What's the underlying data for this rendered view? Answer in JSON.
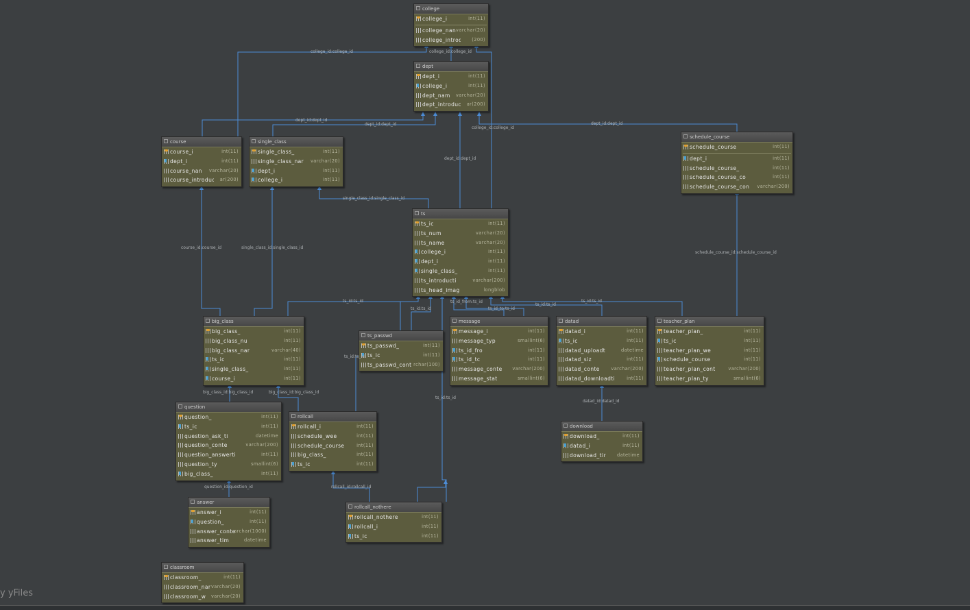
{
  "watermark": "y yFiles",
  "colors": {
    "background": "#3c3f41",
    "table_body": "#5c5c3e",
    "edge": "#4d8dd6",
    "pk": "#e0a030",
    "fk": "#4aa0d0"
  },
  "tables": [
    {
      "id": "college",
      "title": "college",
      "rows": [
        {
          "name": "college_i",
          "type": "int(11)",
          "icon": "pk"
        },
        {
          "sep": true
        },
        {
          "name": "college_nan",
          "type": "varchar(20)",
          "icon": "col"
        },
        {
          "name": "college_introduc",
          "type": "(200)",
          "icon": "col"
        }
      ]
    },
    {
      "id": "dept",
      "title": "dept",
      "rows": [
        {
          "name": "dept_i",
          "type": "int(11)",
          "icon": "pk"
        },
        {
          "name": "college_i",
          "type": "int(11)",
          "icon": "fk"
        },
        {
          "name": "dept_nam",
          "type": "varchar(20)",
          "icon": "col"
        },
        {
          "name": "dept_introduct",
          "type": "ar(200)",
          "icon": "col"
        }
      ]
    },
    {
      "id": "course",
      "title": "course",
      "rows": [
        {
          "name": "course_i",
          "type": "int(11)",
          "icon": "pk"
        },
        {
          "name": "dept_i",
          "type": "int(11)",
          "icon": "fk"
        },
        {
          "name": "course_nan",
          "type": "varchar(20)",
          "icon": "col"
        },
        {
          "name": "course_introduc",
          "type": "ar(200)",
          "icon": "col"
        }
      ]
    },
    {
      "id": "single_class",
      "title": "single_class",
      "rows": [
        {
          "name": "single_class_",
          "type": "int(11)",
          "icon": "pk"
        },
        {
          "name": "single_class_nar",
          "type": "varchar(20)",
          "icon": "col"
        },
        {
          "name": "dept_i",
          "type": "int(11)",
          "icon": "fk"
        },
        {
          "name": "college_i",
          "type": "int(11)",
          "icon": "fk"
        }
      ]
    },
    {
      "id": "schedule_course",
      "title": "schedule_course",
      "rows": [
        {
          "name": "schedule_course",
          "type": "int(11)",
          "icon": "pk"
        },
        {
          "sep": true
        },
        {
          "name": "dept_i",
          "type": "int(11)",
          "icon": "fk"
        },
        {
          "name": "schedule_course_",
          "type": "int(11)",
          "icon": "col"
        },
        {
          "name": "schedule_course_co",
          "type": "int(11)",
          "icon": "col"
        },
        {
          "name": "schedule_course_con",
          "type": "varchar(200)",
          "icon": "col"
        }
      ]
    },
    {
      "id": "ts",
      "title": "ts",
      "rows": [
        {
          "name": "ts_ic",
          "type": "int(11)",
          "icon": "pk"
        },
        {
          "name": "ts_num",
          "type": "varchar(20)",
          "icon": "col"
        },
        {
          "name": "ts_name",
          "type": "varchar(20)",
          "icon": "col"
        },
        {
          "name": "college_i",
          "type": "int(11)",
          "icon": "fk"
        },
        {
          "name": "dept_i",
          "type": "int(11)",
          "icon": "fk"
        },
        {
          "name": "single_class_",
          "type": "int(11)",
          "icon": "fk"
        },
        {
          "name": "ts_introducti",
          "type": "varchar(200)",
          "icon": "col"
        },
        {
          "name": "ts_head_imag",
          "type": "longblob",
          "icon": "col"
        }
      ]
    },
    {
      "id": "big_class",
      "title": "big_class",
      "rows": [
        {
          "name": "big_class_",
          "type": "int(11)",
          "icon": "pk"
        },
        {
          "name": "big_class_nu",
          "type": "int(11)",
          "icon": "col"
        },
        {
          "name": "big_class_nar",
          "type": "varchar(40)",
          "icon": "col"
        },
        {
          "name": "ts_ic",
          "type": "int(11)",
          "icon": "fk"
        },
        {
          "name": "single_class_",
          "type": "int(11)",
          "icon": "fk"
        },
        {
          "name": "course_i",
          "type": "int(11)",
          "icon": "fk"
        }
      ]
    },
    {
      "id": "ts_passwd",
      "title": "ts_passwd",
      "rows": [
        {
          "name": "ts_passwd_",
          "type": "int(11)",
          "icon": "pk"
        },
        {
          "name": "ts_ic",
          "type": "int(11)",
          "icon": "fk"
        },
        {
          "name": "ts_passwd_cont",
          "type": "rchar(100)",
          "icon": "col"
        }
      ]
    },
    {
      "id": "message",
      "title": "message",
      "rows": [
        {
          "name": "message_i",
          "type": "int(11)",
          "icon": "pk"
        },
        {
          "name": "message_typ",
          "type": "smallint(6)",
          "icon": "col"
        },
        {
          "name": "ts_id_fro",
          "type": "int(11)",
          "icon": "fk"
        },
        {
          "name": "ts_id_tc",
          "type": "int(11)",
          "icon": "fk"
        },
        {
          "name": "message_conte",
          "type": "varchar(200)",
          "icon": "col"
        },
        {
          "name": "message_stat",
          "type": "smallint(6)",
          "icon": "col"
        }
      ]
    },
    {
      "id": "datad",
      "title": "datad",
      "rows": [
        {
          "name": "datad_i",
          "type": "int(11)",
          "icon": "pk"
        },
        {
          "name": "ts_ic",
          "type": "int(11)",
          "icon": "fk"
        },
        {
          "name": "datad_uploadt",
          "type": "datetime",
          "icon": "col"
        },
        {
          "name": "datad_siz",
          "type": "int(11)",
          "icon": "col"
        },
        {
          "name": "datad_conte",
          "type": "varchar(200)",
          "icon": "col"
        },
        {
          "name": "datad_downloadti",
          "type": "int(11)",
          "icon": "col"
        }
      ]
    },
    {
      "id": "teacher_plan",
      "title": "teacher_plan",
      "rows": [
        {
          "name": "teacher_plan_",
          "type": "int(11)",
          "icon": "pk"
        },
        {
          "name": "ts_ic",
          "type": "int(11)",
          "icon": "fk"
        },
        {
          "name": "teacher_plan_we",
          "type": "int(11)",
          "icon": "col"
        },
        {
          "name": "schedule_course",
          "type": "int(11)",
          "icon": "fk"
        },
        {
          "name": "teacher_plan_cont",
          "type": "varchar(200)",
          "icon": "col"
        },
        {
          "name": "teacher_plan_ty",
          "type": "smallint(6)",
          "icon": "col"
        }
      ]
    },
    {
      "id": "question",
      "title": "question",
      "rows": [
        {
          "name": "question_",
          "type": "int(11)",
          "icon": "pk"
        },
        {
          "name": "ts_ic",
          "type": "int(11)",
          "icon": "fk"
        },
        {
          "name": "question_ask_ti",
          "type": "datetime",
          "icon": "col"
        },
        {
          "name": "question_conte",
          "type": "varchar(200)",
          "icon": "col"
        },
        {
          "name": "question_answerti",
          "type": "int(11)",
          "icon": "col"
        },
        {
          "name": "question_ty",
          "type": "smallint(6)",
          "icon": "col"
        },
        {
          "name": "big_class_",
          "type": "int(11)",
          "icon": "fk"
        }
      ]
    },
    {
      "id": "rollcall",
      "title": "rollcall",
      "rows": [
        {
          "name": "rollcall_i",
          "type": "int(11)",
          "icon": "pk"
        },
        {
          "name": "schedule_wee",
          "type": "int(11)",
          "icon": "col"
        },
        {
          "name": "schedule_course",
          "type": "int(11)",
          "icon": "col"
        },
        {
          "name": "big_class_",
          "type": "int(11)",
          "icon": "col"
        },
        {
          "name": "ts_ic",
          "type": "int(11)",
          "icon": "fk"
        }
      ]
    },
    {
      "id": "download",
      "title": "download",
      "rows": [
        {
          "name": "download_",
          "type": "int(11)",
          "icon": "pk"
        },
        {
          "name": "datad_i",
          "type": "int(11)",
          "icon": "fk"
        },
        {
          "name": "download_tir",
          "type": "datetime",
          "icon": "col"
        }
      ]
    },
    {
      "id": "answer",
      "title": "answer",
      "rows": [
        {
          "name": "answer_i",
          "type": "int(11)",
          "icon": "pk"
        },
        {
          "name": "question_",
          "type": "int(11)",
          "icon": "fk"
        },
        {
          "name": "answer_conte",
          "type": "archar(1000)",
          "icon": "col"
        },
        {
          "name": "answer_tim",
          "type": "datetime",
          "icon": "col"
        }
      ]
    },
    {
      "id": "rollcall_nothere",
      "title": "rollcall_nothere",
      "rows": [
        {
          "name": "rollcall_nothere",
          "type": "int(11)",
          "icon": "pk"
        },
        {
          "name": "rollcall_i",
          "type": "int(11)",
          "icon": "fk"
        },
        {
          "name": "ts_ic",
          "type": "int(11)",
          "icon": "fk"
        }
      ]
    },
    {
      "id": "classroom",
      "title": "classroom",
      "rows": [
        {
          "name": "classroom_",
          "type": "int(11)",
          "icon": "pk"
        },
        {
          "name": "classroom_nar",
          "type": "varchar(20)",
          "icon": "col"
        },
        {
          "name": "classroom_w",
          "type": "varchar(20)",
          "icon": "col"
        }
      ]
    }
  ],
  "edge_labels": [
    {
      "id": "e1",
      "text": "college_id:college_id"
    },
    {
      "id": "e2",
      "text": "college_id:college_id"
    },
    {
      "id": "e3",
      "text": "dept_id:dept_id"
    },
    {
      "id": "e4",
      "text": "dept_id:dept_id"
    },
    {
      "id": "e5",
      "text": "college_id:college_id"
    },
    {
      "id": "e6",
      "text": "dept_id:dept_id"
    },
    {
      "id": "e7",
      "text": "dept_id:dept_id"
    },
    {
      "id": "e8",
      "text": "single_class_id:single_class_id"
    },
    {
      "id": "e9",
      "text": "course_id:course_id"
    },
    {
      "id": "e10",
      "text": "single_class_id:single_class_id"
    },
    {
      "id": "e11",
      "text": "schedule_course_id:schedule_course_id"
    },
    {
      "id": "e12",
      "text": "ts_id:ts_id"
    },
    {
      "id": "e13",
      "text": "ts_id:ts_id"
    },
    {
      "id": "e14",
      "text": "ts_id_from:ts_id"
    },
    {
      "id": "e15",
      "text": "ts_id_to:ts_id"
    },
    {
      "id": "e16",
      "text": "ts_id:ts_id"
    },
    {
      "id": "e17",
      "text": "ts_id:ts_id"
    },
    {
      "id": "e18",
      "text": "ts_id:ts_id"
    },
    {
      "id": "e19",
      "text": "ts_id:ts_id"
    },
    {
      "id": "e20",
      "text": "big_class_id:big_class_id"
    },
    {
      "id": "e21",
      "text": "big_class_id:big_class_id"
    },
    {
      "id": "e22",
      "text": "datad_id:datad_id"
    },
    {
      "id": "e23",
      "text": "question_id:question_id"
    },
    {
      "id": "e24",
      "text": "rollcall_id:rollcall_id"
    }
  ]
}
